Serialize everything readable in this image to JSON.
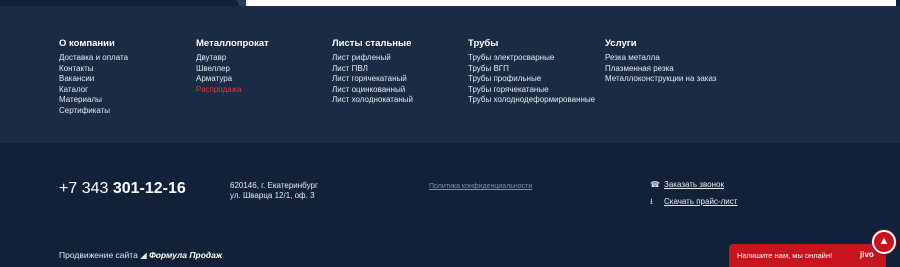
{
  "footer": {
    "columns": [
      {
        "heading": "О компании",
        "items": [
          "Доставка и оплата",
          "Контакты",
          "Вакансии",
          "Каталог",
          "Материалы",
          "Сертификаты"
        ]
      },
      {
        "heading": "Металлопрокат",
        "items": [
          "Двутавр",
          "Швеллер",
          "Арматура",
          "Распродажа"
        ],
        "highlight_index": 3
      },
      {
        "heading": "Листы стальные",
        "items": [
          "Лист рифленый",
          "Лист ПВЛ",
          "Лист горячекатаный",
          "Лист оцинкованный",
          "Лист холоднокатаный"
        ]
      },
      {
        "heading": "Трубы",
        "items": [
          "Трубы электросварные",
          "Трубы ВГП",
          "Трубы профильные",
          "Трубы горячекатаные",
          "Трубы холоднодеформированные"
        ]
      },
      {
        "heading": "Услуги",
        "items": [
          "Резка металла",
          "Плазменная резка",
          "Металлоконструкции на заказ"
        ]
      }
    ],
    "phone_prefix": "+7 343",
    "phone_number": "301-12-16",
    "address_line1": "620146, г. Екатеринбург",
    "address_line2": "ул. Шварца 12/1, оф. 3",
    "privacy_link": "Политика конфиденциальности",
    "callback_link": "Заказать звонок",
    "pricelist_link": "Скачать прайс-лист",
    "promo_label": "Продвижение сайта",
    "promo_brand": "Формула Продаж"
  },
  "chat_widget": {
    "message": "Напишите нам, мы онлайн!",
    "brand": "jivo"
  },
  "icons": {
    "callback": "phone-handset-icon",
    "pricelist": "download-document-icon",
    "scroll_up": "chevron-up-icon",
    "promo": "triangle-logo-icon"
  },
  "colors": {
    "upper_bg": "#1a2b45",
    "lower_bg": "#12213a",
    "accent_red": "#e5363a",
    "chat_red": "#c8141d"
  }
}
